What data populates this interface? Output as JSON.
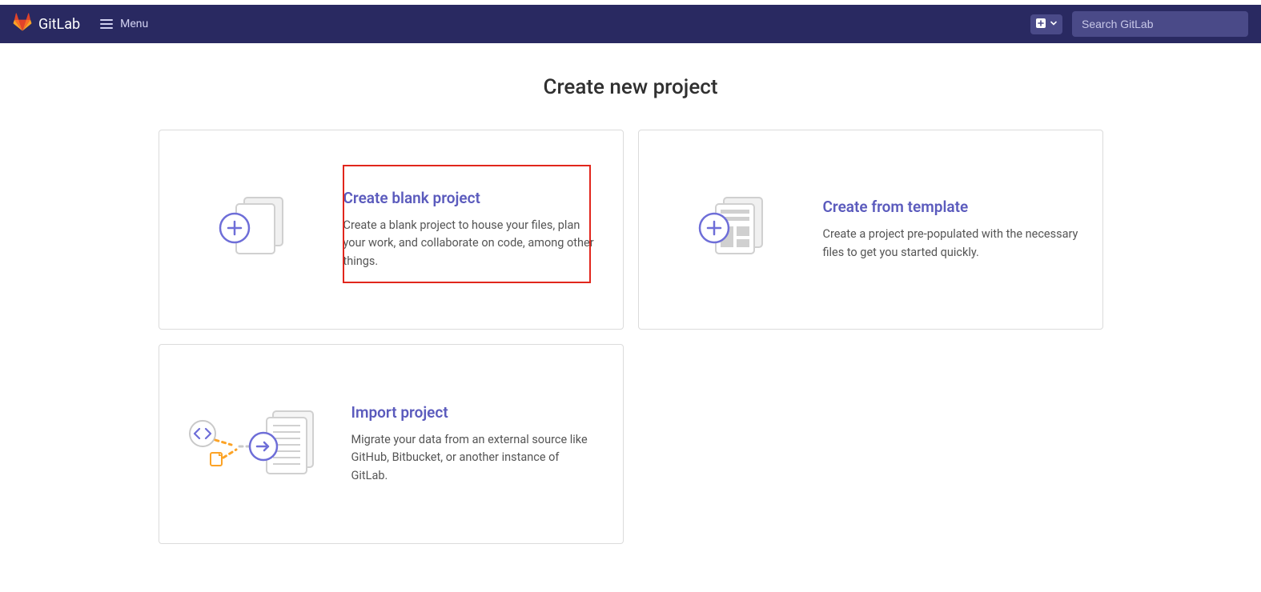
{
  "navbar": {
    "brand": "GitLab",
    "menu_label": "Menu",
    "search_placeholder": "Search GitLab"
  },
  "page": {
    "title": "Create new project"
  },
  "cards": {
    "blank": {
      "title": "Create blank project",
      "desc": "Create a blank project to house your files, plan your work, and collaborate on code, among other things."
    },
    "template": {
      "title": "Create from template",
      "desc": "Create a project pre-populated with the necessary files to get you started quickly."
    },
    "import": {
      "title": "Import project",
      "desc": "Migrate your data from an external source like GitHub, Bitbucket, or another instance of GitLab."
    }
  }
}
